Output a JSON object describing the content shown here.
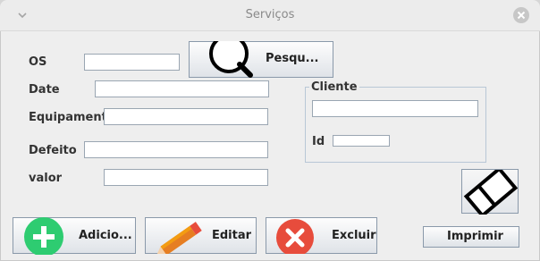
{
  "window": {
    "title": "Serviços"
  },
  "icons": {
    "menu": "chevron-down-icon",
    "close": "close-icon",
    "search": "magnifier-icon",
    "add": "plus-icon",
    "edit": "pencil-icon",
    "delete": "x-icon",
    "print": "eraser-icon"
  },
  "form": {
    "os_label": "OS",
    "os_value": "",
    "date_label": "Date",
    "date_value": "",
    "equip_label": "Equipament",
    "equip_value": "",
    "defect_label": "Defeito",
    "defect_value": "",
    "value_label": "valor",
    "value_value": ""
  },
  "search_button": {
    "label": "Pesqu..."
  },
  "client": {
    "title": "Cliente",
    "name_value": "",
    "id_label": "Id",
    "id_value": ""
  },
  "actions": {
    "add_label": "Adicio...",
    "edit_label": "Editar",
    "delete_label": "Excluir",
    "print_label": "Imprimir"
  },
  "colors": {
    "add": "#2ecc71",
    "edit": "#e67e22",
    "delete": "#e74c3c"
  }
}
